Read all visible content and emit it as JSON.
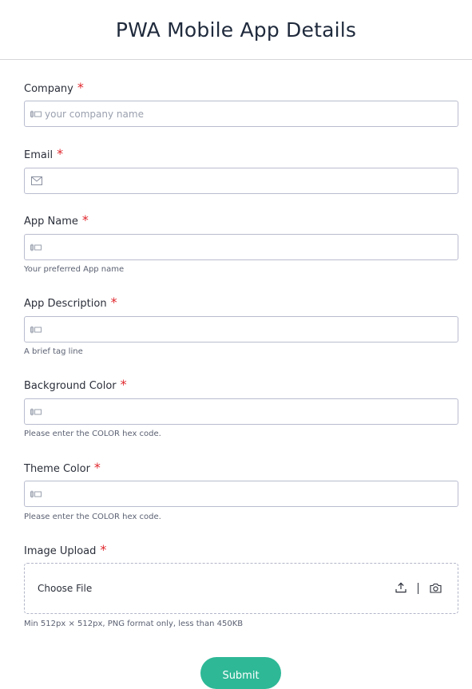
{
  "header": {
    "title": "PWA Mobile App Details"
  },
  "required_marker": "*",
  "fields": {
    "company": {
      "label": "Company",
      "placeholder": "your company name",
      "icon": "text-field-icon"
    },
    "email": {
      "label": "Email",
      "placeholder": "",
      "icon": "envelope-icon"
    },
    "app_name": {
      "label": "App Name",
      "placeholder": "",
      "help": "Your preferred App name",
      "icon": "text-field-icon"
    },
    "app_description": {
      "label": "App Description",
      "placeholder": "",
      "help": "A brief tag line",
      "icon": "text-field-icon"
    },
    "background_color": {
      "label": "Background Color",
      "placeholder": "",
      "help": "Please enter the COLOR hex code.",
      "icon": "text-field-icon"
    },
    "theme_color": {
      "label": "Theme Color",
      "placeholder": "",
      "help": "Please enter the COLOR hex code.",
      "icon": "text-field-icon"
    },
    "image_upload": {
      "label": "Image Upload",
      "choose_label": "Choose File",
      "help": "Min 512px × 512px, PNG format only, less than 450KB",
      "icons": [
        "upload-icon",
        "camera-icon"
      ]
    }
  },
  "submit": {
    "label": "Submit"
  },
  "colors": {
    "accent": "#2eb896",
    "required": "#e0262c",
    "border": "#b9bccf"
  }
}
